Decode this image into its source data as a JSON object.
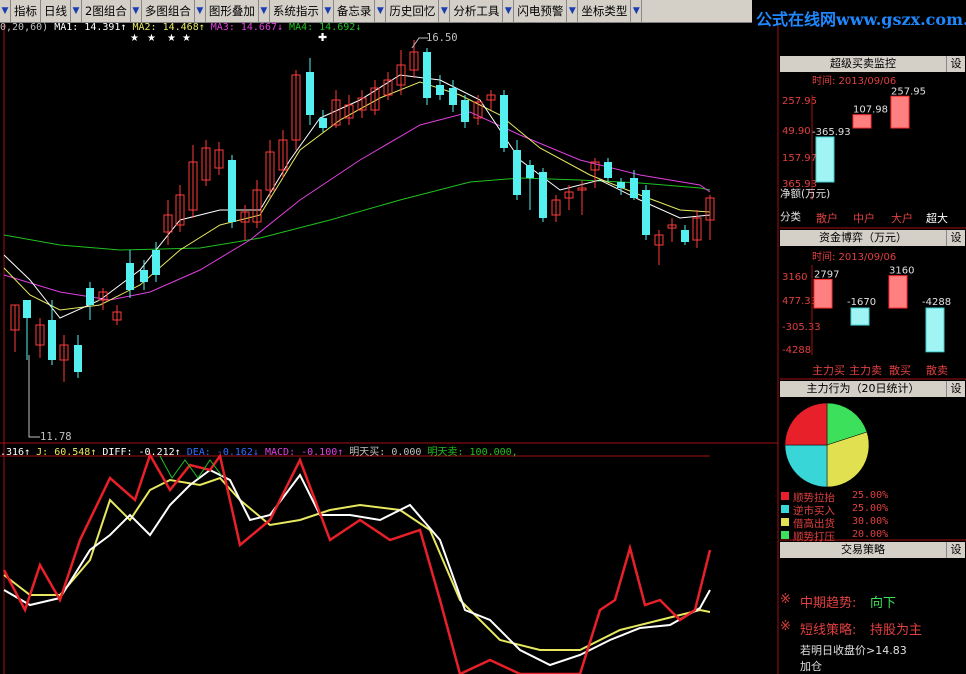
{
  "toolbar": {
    "items": [
      "指标",
      "日线",
      "2图组合",
      "多图组合",
      "图形叠加",
      "系统指示",
      "备忘录",
      "历史回忆",
      "分析工具",
      "闪电预警",
      "坐标类型"
    ]
  },
  "watermark": "公式在线网www.gszx.com.cn",
  "ma_legend": {
    "prefix": "0,20,60)",
    "ma1": "MA1: 14.391↑",
    "ma2": "MA2: 14.468↑",
    "ma3": "MA3: 14.667↓",
    "ma4": "MA4: 14.692↓"
  },
  "price_labels": {
    "high": "16.50",
    "low": "11.78"
  },
  "indicator_legend": {
    "k": ".316↑",
    "j": "J: 60.548↑",
    "diff": "DIFF: -0.212↑",
    "dea": "DEA: -0.162↓",
    "macd": "MACD: -0.100↑",
    "buy": "明天买: 0.000",
    "sell": "明天卖: 100.000,"
  },
  "panel1": {
    "title": "超级买卖监控",
    "time": "时间: 2013/09/06",
    "y_ticks": [
      "257.95",
      "49.90",
      "157.97",
      "365.93"
    ],
    "bars": [
      {
        "label": "散户",
        "value": -365.93,
        "text": "-365.93"
      },
      {
        "label": "中户",
        "value": 107.98,
        "text": "107.98"
      },
      {
        "label": "大户",
        "value": 257.95,
        "text": "257.95"
      },
      {
        "label": "超大",
        "value": 0,
        "text": ""
      }
    ],
    "net_label": "净额(万元)",
    "cat_label": "分类",
    "set": "设"
  },
  "panel2": {
    "title": "资金博弈（万元）",
    "time": "时间: 2013/09/06",
    "y_ticks": [
      "3160",
      "477.33",
      "-305.33",
      "-4288"
    ],
    "bars": [
      {
        "label": "主力买",
        "value": 2797,
        "text": "2797"
      },
      {
        "label": "主力卖",
        "value": -1670,
        "text": "-1670"
      },
      {
        "label": "散买",
        "value": 3160,
        "text": "3160"
      },
      {
        "label": "散卖",
        "value": -4288,
        "text": "-4288"
      }
    ],
    "set": "设"
  },
  "panel3": {
    "title": "主力行为（20日统计）",
    "set": "设",
    "slices": [
      {
        "name": "顺势拉抬",
        "pct": "25.00%",
        "value": 25,
        "color": "#e8202a"
      },
      {
        "name": "逆市买入",
        "pct": "25.00%",
        "value": 25,
        "color": "#38d6d6"
      },
      {
        "name": "借高出货",
        "pct": "30.00%",
        "value": 30,
        "color": "#e0e050"
      },
      {
        "name": "顺势打压",
        "pct": "20.00%",
        "value": 20,
        "color": "#3ce05a"
      }
    ]
  },
  "panel4": {
    "title": "交易策略",
    "set": "设",
    "mid_label": "中期趋势:",
    "mid_value": "向下",
    "short_label": "短线策略:",
    "short_value": "持股为主",
    "note1": "若明日收盘价>14.83",
    "note2": "加仓",
    "mark": "※"
  },
  "colors": {
    "up": "#ff3d3d",
    "down": "#54f0f0",
    "ma1": "#ffffff",
    "ma2": "#e8e860",
    "ma3": "#e040e0",
    "ma4": "#20c020"
  }
}
